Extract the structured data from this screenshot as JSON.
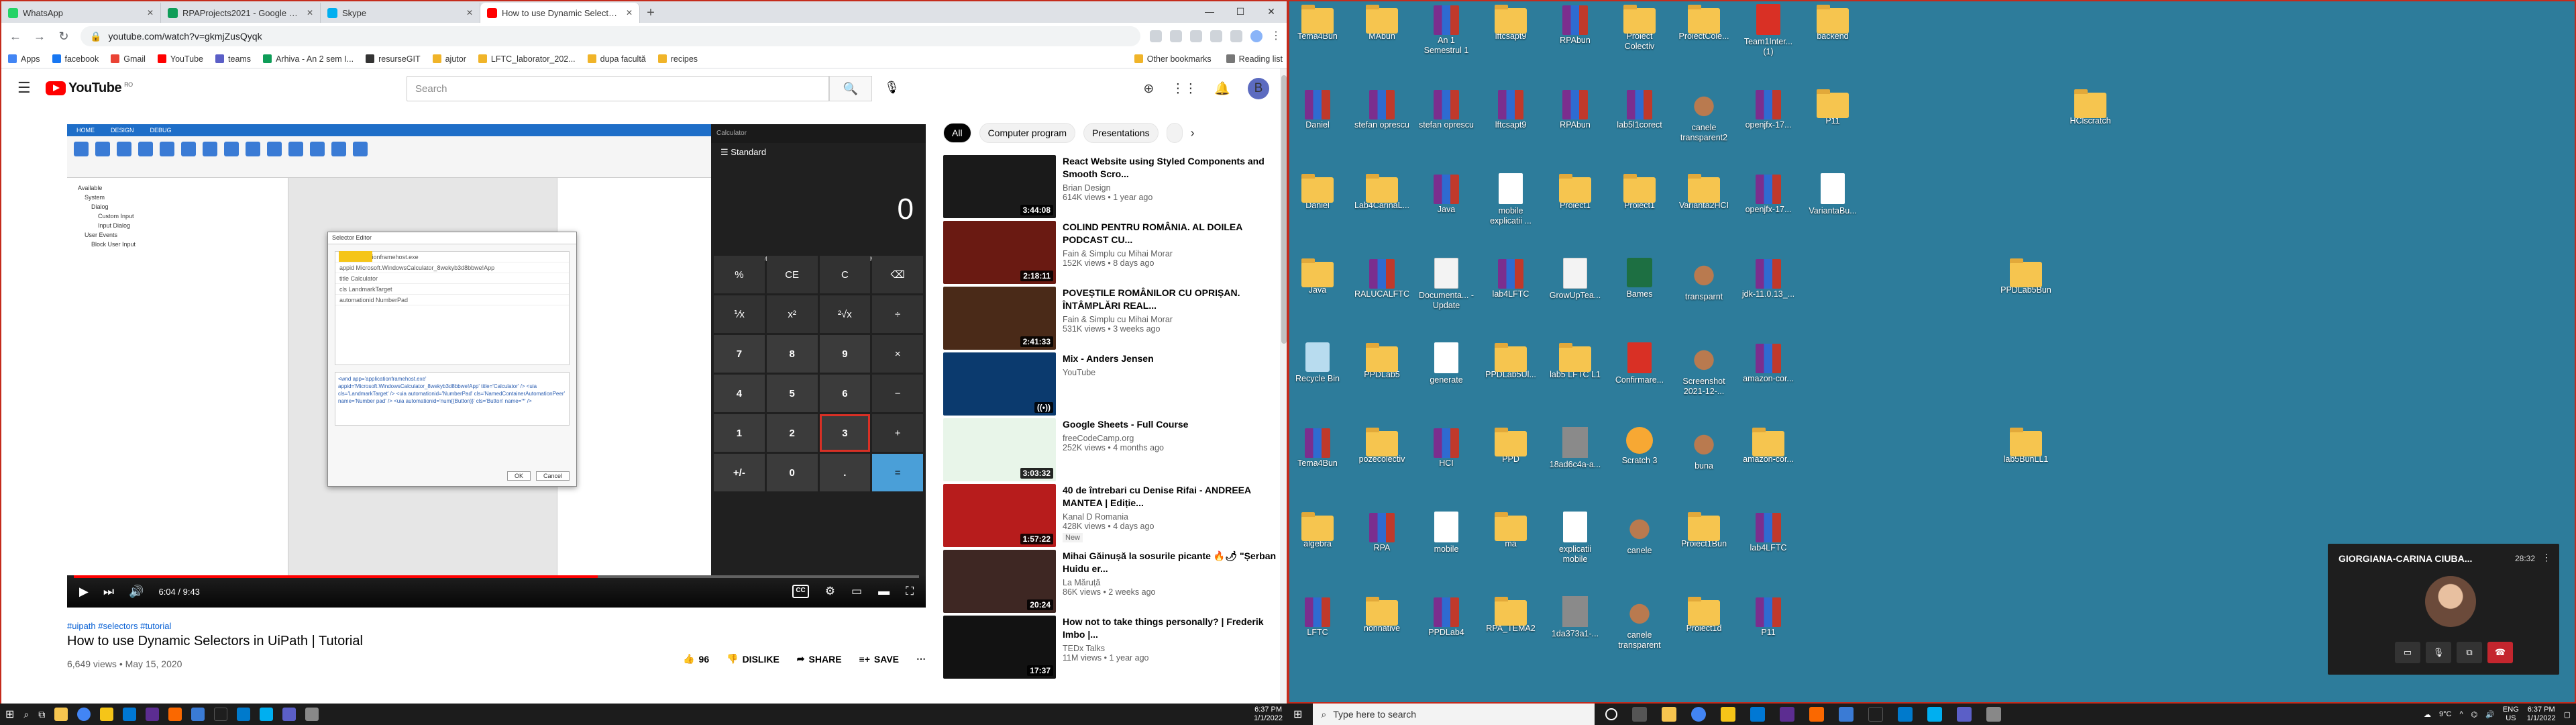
{
  "browser": {
    "tabs": [
      {
        "label": "WhatsApp",
        "color": "#25d366"
      },
      {
        "label": "RPAProjects2021 - Google Sheets",
        "color": "#0f9d58"
      },
      {
        "label": "Skype",
        "color": "#00aff0"
      },
      {
        "label": "How to use Dynamic Selectors in",
        "color": "#ff0000"
      }
    ],
    "url": "youtube.com/watch?v=gkmjZusQyqk",
    "bookmarks": [
      "Apps",
      "facebook",
      "Gmail",
      "YouTube",
      "teams",
      "Arhiva - An 2 sem I...",
      "resurseGIT",
      "ajutor",
      "LFTC_laborator_202...",
      "dupa facultă",
      "recipes"
    ],
    "bookmarks_right": [
      "Other bookmarks",
      "Reading list"
    ]
  },
  "youtube": {
    "logo": "YouTube",
    "country": "RO",
    "search_placeholder": "Search",
    "avatar_letter": "B",
    "video": {
      "tags": "#uipath #selectors #tutorial",
      "title": "How to use Dynamic Selectors in UiPath | Tutorial",
      "meta": "6,649 views • May 15, 2020",
      "time": "6:04 / 9:43",
      "progress": 0.62,
      "likes": "96",
      "dislike": "DISLIKE",
      "share": "SHARE",
      "save": "SAVE"
    },
    "player": {
      "calc_title": "Calculator",
      "calc_mode": "Standard",
      "calc_display": "0",
      "calc_memory": [
        "MC",
        "MR",
        "M+",
        "M-",
        "MS",
        "M"
      ],
      "calc_keys": [
        "%",
        "CE",
        "C",
        "⌫",
        "⅟x",
        "x²",
        "²√x",
        "÷",
        "7",
        "8",
        "9",
        "×",
        "4",
        "5",
        "6",
        "−",
        "1",
        "2",
        "3",
        "+",
        "+/-",
        "0",
        ".",
        "="
      ],
      "dialog_title": "Selector Editor",
      "dialog_rows": [
        "app  applicationframehost.exe",
        "appid  Microsoft.WindowsCalculator_8wekyb3d8bbwe!App",
        "title  Calculator",
        "cls  LandmarkTarget",
        "automationid  NumberPad"
      ],
      "dialog_code": "<wnd app='applicationframehost.exe' appid='Microsoft.WindowsCalculator_8wekyb3d8bbwe!App' title='Calculator' /> <uia cls='LandmarkTarget' /> <uia automationid='NumberPad' cls='NamedContainerAutomationPeer' name='Number pad' /> <uia automationid='num{{Button}}' cls='Button' name='*' />",
      "dialog_buttons": [
        "OK",
        "Cancel"
      ],
      "sidebar_items": [
        "Available",
        "System",
        "Dialog",
        "Custom Input",
        "Input Dialog",
        "User Events",
        "Block User Input"
      ]
    },
    "chips": [
      "All",
      "Computer program",
      "Presentations"
    ],
    "recs": [
      {
        "title": "React Website using Styled Components and Smooth Scro...",
        "channel": "Brian Design",
        "views": "614K views • 1 year ago",
        "dur": "3:44:08",
        "bg": "#1a1a1a"
      },
      {
        "title": "COLIND PENTRU ROMÂNIA. AL DOILEA PODCAST CU...",
        "channel": "Fain & Simplu cu Mihai Morar",
        "views": "152K views • 8 days ago",
        "dur": "2:18:11",
        "bg": "#6a1a12"
      },
      {
        "title": "POVEȘTILE ROMÂNILOR CU OPRIȘAN. ÎNTÂMPLĂRI REAL...",
        "channel": "Fain & Simplu cu Mihai Morar",
        "views": "531K views • 3 weeks ago",
        "dur": "2:41:33",
        "bg": "#4a2a18"
      },
      {
        "title": "Mix - Anders Jensen",
        "channel": "YouTube",
        "views": "",
        "dur": "((•))",
        "bg": "#0b3a6e"
      },
      {
        "title": "Google Sheets - Full Course",
        "channel": "freeCodeCamp.org",
        "views": "252K views • 4 months ago",
        "dur": "3:03:32",
        "bg": "#e8f5e9"
      },
      {
        "title": "40 de întrebari cu Denise Rifai - ANDREEA MANTEA | Ediție...",
        "channel": "Kanal D Romania",
        "views": "428K views • 4 days ago",
        "dur": "1:57:22",
        "bg": "#b71c1c",
        "badge": "New"
      },
      {
        "title": "Mihai Găinușă la sosurile picante 🔥🌶 \"Șerban Huidu er...",
        "channel": "La Măruță",
        "views": "86K views • 2 weeks ago",
        "dur": "20:24",
        "bg": "#3e2723"
      },
      {
        "title": "How not to take things personally? | Frederik Imbo |...",
        "channel": "TEDx Talks",
        "views": "11M views • 1 year ago",
        "dur": "17:37",
        "bg": "#121212"
      }
    ]
  },
  "taskbar_left": {
    "time": "6:37 PM",
    "date": "1/1/2022"
  },
  "desktop": {
    "icons": [
      {
        "label": "Tema4Bun",
        "type": "folder",
        "col": 0,
        "row": 0
      },
      {
        "label": "MAbun",
        "type": "folder",
        "col": 1,
        "row": 0
      },
      {
        "label": "An 1 Semestrul 1",
        "type": "rar",
        "col": 2,
        "row": 0
      },
      {
        "label": "lftcsapt9",
        "type": "folder",
        "col": 3,
        "row": 0
      },
      {
        "label": "RPAbun",
        "type": "rar",
        "col": 4,
        "row": 0
      },
      {
        "label": "Proiect Colectiv",
        "type": "folder",
        "col": 5,
        "row": 0
      },
      {
        "label": "ProiectCole...",
        "type": "folder",
        "col": 6,
        "row": 0
      },
      {
        "label": "Team1Inter... (1)",
        "type": "pdf",
        "col": 7,
        "row": 0
      },
      {
        "label": "backend",
        "type": "folder",
        "col": 8,
        "row": 0
      },
      {
        "label": "Daniel",
        "type": "rar",
        "col": 0,
        "row": 1
      },
      {
        "label": "stefan oprescu",
        "type": "rar",
        "col": 1,
        "row": 1
      },
      {
        "label": "stefan oprescu",
        "type": "rar",
        "col": 2,
        "row": 1
      },
      {
        "label": "lftcsapt9",
        "type": "rar",
        "col": 3,
        "row": 1
      },
      {
        "label": "RPAbun",
        "type": "rar",
        "col": 4,
        "row": 1
      },
      {
        "label": "lab5l1corect",
        "type": "rar",
        "col": 5,
        "row": 1
      },
      {
        "label": "canele transparent2",
        "type": "dog",
        "col": 6,
        "row": 1
      },
      {
        "label": "openjfx-17...",
        "type": "rar",
        "col": 7,
        "row": 1
      },
      {
        "label": "P11",
        "type": "folder",
        "col": 8,
        "row": 1
      },
      {
        "label": "HClscratch",
        "type": "folder",
        "col": 12,
        "row": 1
      },
      {
        "label": "Daniel",
        "type": "folder",
        "col": 0,
        "row": 2
      },
      {
        "label": "Lab4CarinaL...",
        "type": "folder",
        "col": 1,
        "row": 2
      },
      {
        "label": "Java",
        "type": "rar",
        "col": 2,
        "row": 2
      },
      {
        "label": "mobile explicatii ...",
        "type": "doc",
        "col": 3,
        "row": 2
      },
      {
        "label": "Proiect1",
        "type": "folder",
        "col": 4,
        "row": 2
      },
      {
        "label": "Proiect1",
        "type": "folder",
        "col": 5,
        "row": 2
      },
      {
        "label": "Varianta2HCI",
        "type": "folder",
        "col": 6,
        "row": 2
      },
      {
        "label": "openjfx-17...",
        "type": "rar",
        "col": 7,
        "row": 2
      },
      {
        "label": "VariantaBu...",
        "type": "doc",
        "col": 8,
        "row": 2
      },
      {
        "label": "Java",
        "type": "folder",
        "col": 0,
        "row": 3
      },
      {
        "label": "RALUCALFTC",
        "type": "rar",
        "col": 1,
        "row": 3
      },
      {
        "label": "Documenta... - Update",
        "type": "doc2",
        "col": 2,
        "row": 3
      },
      {
        "label": "lab4LFTC",
        "type": "rar",
        "col": 3,
        "row": 3
      },
      {
        "label": "GrowUpTea...",
        "type": "doc2",
        "col": 4,
        "row": 3
      },
      {
        "label": "Bames",
        "type": "xls",
        "col": 5,
        "row": 3
      },
      {
        "label": "transparnt",
        "type": "dog",
        "col": 6,
        "row": 3
      },
      {
        "label": "jdk-11.0.13_...",
        "type": "rar",
        "col": 7,
        "row": 3
      },
      {
        "label": "PPDLab5Bun",
        "type": "folder",
        "col": 11,
        "row": 3
      },
      {
        "label": "Recycle Bin",
        "type": "bin",
        "col": 0,
        "row": 4
      },
      {
        "label": "PPDLab5",
        "type": "folder",
        "col": 1,
        "row": 4
      },
      {
        "label": "generate",
        "type": "doc",
        "col": 2,
        "row": 4
      },
      {
        "label": "PPDLab5Ul...",
        "type": "folder",
        "col": 3,
        "row": 4
      },
      {
        "label": "lab5 LFTC L1",
        "type": "folder",
        "col": 4,
        "row": 4
      },
      {
        "label": "Confirmare...",
        "type": "pdf",
        "col": 5,
        "row": 4
      },
      {
        "label": "Screenshot 2021-12-...",
        "type": "dog",
        "col": 6,
        "row": 4
      },
      {
        "label": "amazon-cor...",
        "type": "rar",
        "col": 7,
        "row": 4
      },
      {
        "label": "Tema4Bun",
        "type": "rar",
        "col": 0,
        "row": 5
      },
      {
        "label": "pozecolectiv",
        "type": "folder",
        "col": 1,
        "row": 5
      },
      {
        "label": "HCI",
        "type": "rar",
        "col": 2,
        "row": 5
      },
      {
        "label": "PPD",
        "type": "folder",
        "col": 3,
        "row": 5
      },
      {
        "label": "18ad6c4a-a...",
        "type": "img",
        "col": 4,
        "row": 5
      },
      {
        "label": "Scratch 3",
        "type": "scratch",
        "col": 5,
        "row": 5
      },
      {
        "label": "buna",
        "type": "dog",
        "col": 6,
        "row": 5
      },
      {
        "label": "amazon-cor...",
        "type": "folder",
        "col": 7,
        "row": 5
      },
      {
        "label": "lab5BunLL1",
        "type": "folder",
        "col": 11,
        "row": 5
      },
      {
        "label": "algebra",
        "type": "folder",
        "col": 0,
        "row": 6
      },
      {
        "label": "RPA",
        "type": "rar",
        "col": 1,
        "row": 6
      },
      {
        "label": "mobile",
        "type": "doc",
        "col": 2,
        "row": 6
      },
      {
        "label": "ma",
        "type": "folder",
        "col": 3,
        "row": 6
      },
      {
        "label": "explicatii mobile",
        "type": "doc",
        "col": 4,
        "row": 6
      },
      {
        "label": "canele",
        "type": "dog",
        "col": 5,
        "row": 6
      },
      {
        "label": "Proiect1Bun",
        "type": "folder",
        "col": 6,
        "row": 6
      },
      {
        "label": "lab4LFTC",
        "type": "rar",
        "col": 7,
        "row": 6
      },
      {
        "label": "LFTC",
        "type": "rar",
        "col": 0,
        "row": 7
      },
      {
        "label": "nonnative",
        "type": "folder",
        "col": 1,
        "row": 7
      },
      {
        "label": "PPDLab4",
        "type": "rar",
        "col": 2,
        "row": 7
      },
      {
        "label": "RPA_TEMA2",
        "type": "folder",
        "col": 3,
        "row": 7
      },
      {
        "label": "1da373a1-...",
        "type": "img",
        "col": 4,
        "row": 7
      },
      {
        "label": "canele transparent",
        "type": "dog",
        "col": 5,
        "row": 7
      },
      {
        "label": "Proiect1d",
        "type": "folder",
        "col": 6,
        "row": 7
      },
      {
        "label": "P11",
        "type": "rar",
        "col": 7,
        "row": 7
      }
    ]
  },
  "taskbar_right": {
    "search_placeholder": "Type here to search",
    "temp": "9°C",
    "lang": "ENG",
    "region": "US",
    "time": "6:37 PM",
    "date": "1/1/2022"
  },
  "skype": {
    "name": "GIORGIANA-CARINA CIUBA...",
    "time": "28:32"
  }
}
